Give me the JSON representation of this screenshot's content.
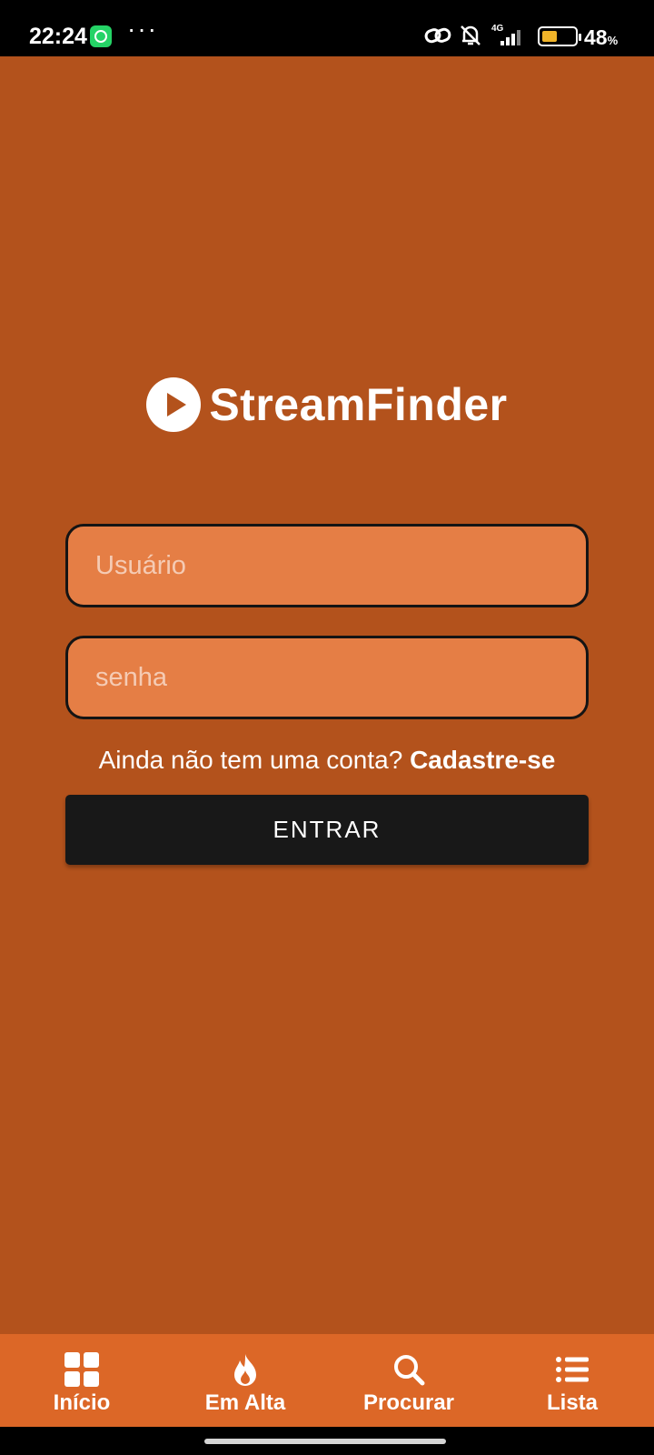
{
  "status_bar": {
    "time": "22:24",
    "network": "4G",
    "battery_level": 0.48,
    "battery_text": "48",
    "battery_unit": "%"
  },
  "brand": {
    "name": "StreamFinder"
  },
  "login_form": {
    "username_placeholder": "Usuário",
    "password_placeholder": "senha",
    "signup_prompt": "Ainda não tem uma conta? ",
    "signup_link": "Cadastre-se",
    "submit_label": "ENTRAR"
  },
  "bottom_nav": {
    "items": [
      {
        "label": "Início",
        "icon": "grid-icon"
      },
      {
        "label": "Em Alta",
        "icon": "flame-icon"
      },
      {
        "label": "Procurar",
        "icon": "search-icon"
      },
      {
        "label": "Lista",
        "icon": "list-icon"
      }
    ]
  },
  "colors": {
    "background": "#b3521c",
    "input_fill": "#e57e45",
    "button": "#181818",
    "nav_bar": "#dc6727"
  }
}
